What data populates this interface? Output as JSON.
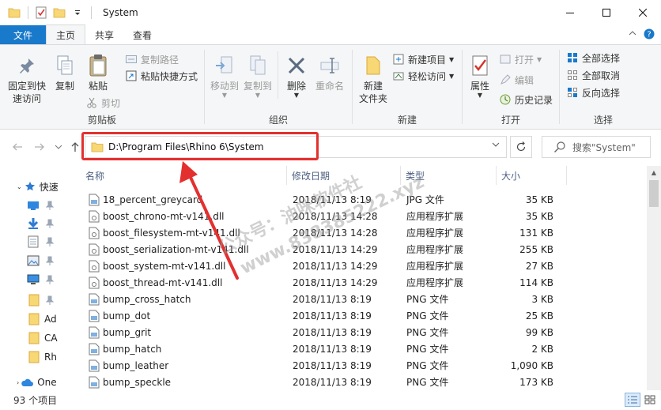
{
  "window": {
    "title": "System"
  },
  "ribbon_tabs": [
    {
      "label": "文件"
    },
    {
      "label": "主页"
    },
    {
      "label": "共享"
    },
    {
      "label": "查看"
    }
  ],
  "ribbon": {
    "clipboard": {
      "label": "剪贴板",
      "pin": "固定到快\n速访问",
      "copy": "复制",
      "paste": "粘贴",
      "copy_path": "复制路径",
      "paste_shortcut": "粘贴快捷方式",
      "cut": "剪切"
    },
    "organize": {
      "label": "组织",
      "move_to": "移动到",
      "copy_to": "复制到",
      "delete": "删除",
      "rename": "重命名"
    },
    "new": {
      "label": "新建",
      "new_folder": "新建\n文件夹",
      "new_item": "新建项目",
      "easy_access": "轻松访问"
    },
    "open": {
      "label": "打开",
      "properties": "属性",
      "open": "打开",
      "edit": "编辑",
      "history": "历史记录"
    },
    "select": {
      "label": "选择",
      "select_all": "全部选择",
      "select_none": "全部取消",
      "invert": "反向选择"
    }
  },
  "address_bar": {
    "path": "D:\\Program Files\\Rhino 6\\System"
  },
  "search": {
    "placeholder": "搜索\"System\""
  },
  "columns": {
    "name": "名称",
    "date": "修改日期",
    "type": "类型",
    "size": "大小"
  },
  "sidebar": {
    "items": [
      {
        "label": "快速"
      },
      {
        "label": ""
      },
      {
        "label": ""
      },
      {
        "label": ""
      },
      {
        "label": ""
      },
      {
        "label": ""
      },
      {
        "label": ""
      },
      {
        "label": "Ad"
      },
      {
        "label": "CA"
      },
      {
        "label": "Rh"
      },
      {
        "label": "One"
      }
    ]
  },
  "files": [
    {
      "name": "18_percent_greycard",
      "date": "2018/11/13 8:19",
      "type": "JPG 文件",
      "size": "35 KB"
    },
    {
      "name": "boost_chrono-mt-v141.dll",
      "date": "2018/11/13 14:28",
      "type": "应用程序扩展",
      "size": "35 KB"
    },
    {
      "name": "boost_filesystem-mt-v141.dll",
      "date": "2018/11/13 14:28",
      "type": "应用程序扩展",
      "size": "131 KB"
    },
    {
      "name": "boost_serialization-mt-v141.dll",
      "date": "2018/11/13 14:29",
      "type": "应用程序扩展",
      "size": "255 KB"
    },
    {
      "name": "boost_system-mt-v141.dll",
      "date": "2018/11/13 14:29",
      "type": "应用程序扩展",
      "size": "27 KB"
    },
    {
      "name": "boost_thread-mt-v141.dll",
      "date": "2018/11/13 14:29",
      "type": "应用程序扩展",
      "size": "114 KB"
    },
    {
      "name": "bump_cross_hatch",
      "date": "2018/11/13 8:19",
      "type": "PNG 文件",
      "size": "3 KB"
    },
    {
      "name": "bump_dot",
      "date": "2018/11/13 8:19",
      "type": "PNG 文件",
      "size": "25 KB"
    },
    {
      "name": "bump_grit",
      "date": "2018/11/13 8:19",
      "type": "PNG 文件",
      "size": "99 KB"
    },
    {
      "name": "bump_hatch",
      "date": "2018/11/13 8:19",
      "type": "PNG 文件",
      "size": "2 KB"
    },
    {
      "name": "bump_leather",
      "date": "2018/11/13 8:19",
      "type": "PNG 文件",
      "size": "1,090 KB"
    },
    {
      "name": "bump_speckle",
      "date": "2018/11/13 8:19",
      "type": "PNG 文件",
      "size": "173 KB"
    }
  ],
  "status": {
    "count": "93 个项目"
  },
  "watermark": {
    "line1": "公众号：油咪软件社",
    "line2": "www.838385222.xyz"
  },
  "colors": {
    "accent": "#1979ca",
    "highlight": "#e3302f",
    "folder": "#f8d775"
  }
}
